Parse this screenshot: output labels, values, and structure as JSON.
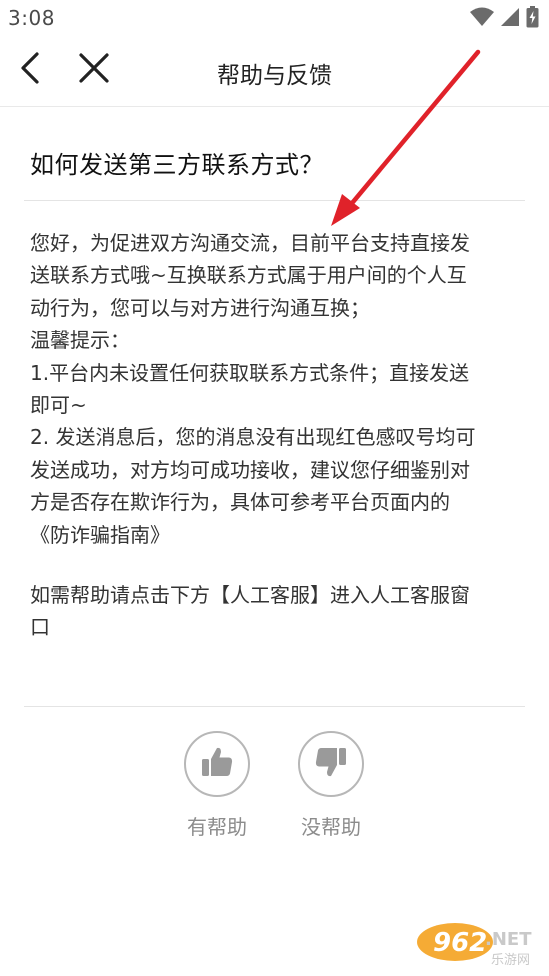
{
  "status_bar": {
    "time": "3:08"
  },
  "header": {
    "back_icon": "chevron-left-icon",
    "close_icon": "close-icon",
    "title": "帮助与反馈"
  },
  "article": {
    "question": "如何发送第三方联系方式？",
    "lines": [
      "您好，为促进双方沟通交流，目前平台支持直接发",
      "送联系方式哦~互换联系方式属于用户间的个人互",
      "动行为，您可以与对方进行沟通互换；",
      "温馨提示：",
      "1.平台内未设置任何获取联系方式条件；直接发送",
      "即可~",
      "2. 发送消息后，您的消息没有出现红色感叹号均可",
      "发送成功，对方均可成功接收，建议您仔细鉴别对",
      "方是否存在欺诈行为，具体可参考平台页面内的",
      "《防诈骗指南》"
    ],
    "footer_lines": [
      "如需帮助请点击下方【人工客服】进入人工客服窗",
      "口"
    ]
  },
  "feedback": {
    "helpful_label": "有帮助",
    "helpful_icon": "thumbs-up-icon",
    "not_helpful_label": "没帮助",
    "not_helpful_icon": "thumbs-down-icon"
  },
  "annotation": {
    "arrow_color": "#e0222a"
  },
  "watermark": {
    "number": "962",
    "net": ".NET",
    "site": "乐游网"
  },
  "colors": {
    "icon_gray": "#b7b7b7",
    "label_gray": "#8c8c8c",
    "divider": "#e4e4e4"
  }
}
